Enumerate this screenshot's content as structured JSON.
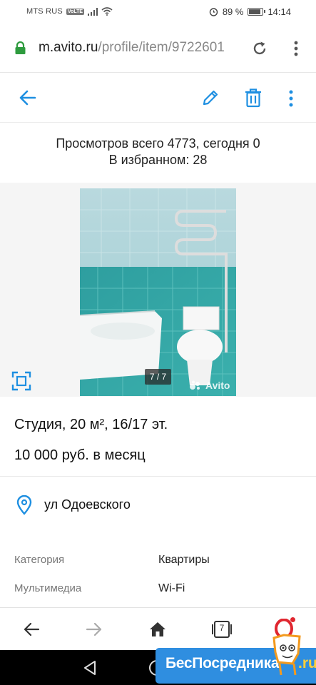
{
  "status_bar": {
    "carrier": "MTS RUS",
    "volte": "VoLTE",
    "battery": "89 %",
    "battery_level": 0.89,
    "time": "14:14"
  },
  "browser": {
    "url_host": "m.avito.ru",
    "url_path": "/profile/item/9722601"
  },
  "stats": {
    "views_line": "Просмотров всего 4773, сегодня 0",
    "favorites_line": "В избранном: 28"
  },
  "gallery": {
    "counter": "7 / 7",
    "watermark": "Avito"
  },
  "listing": {
    "title": "Студия, 20 м², 16/17 эт.",
    "price": "10 000 руб. в месяц",
    "address": "ул Одоевского"
  },
  "params": [
    {
      "label": "Категория",
      "value": "Квартиры"
    },
    {
      "label": "Мультимедиа",
      "value": "Wi-Fi"
    }
  ],
  "bottom_nav": {
    "tabs_count": "7"
  },
  "banner": {
    "text": "БесПосредника",
    "suffix": ".ru"
  },
  "colors": {
    "accent": "#1e8fe1",
    "lock_green": "#2e9b3e",
    "opera_red": "#e0262f",
    "banner_blue": "#2f8ee0"
  }
}
